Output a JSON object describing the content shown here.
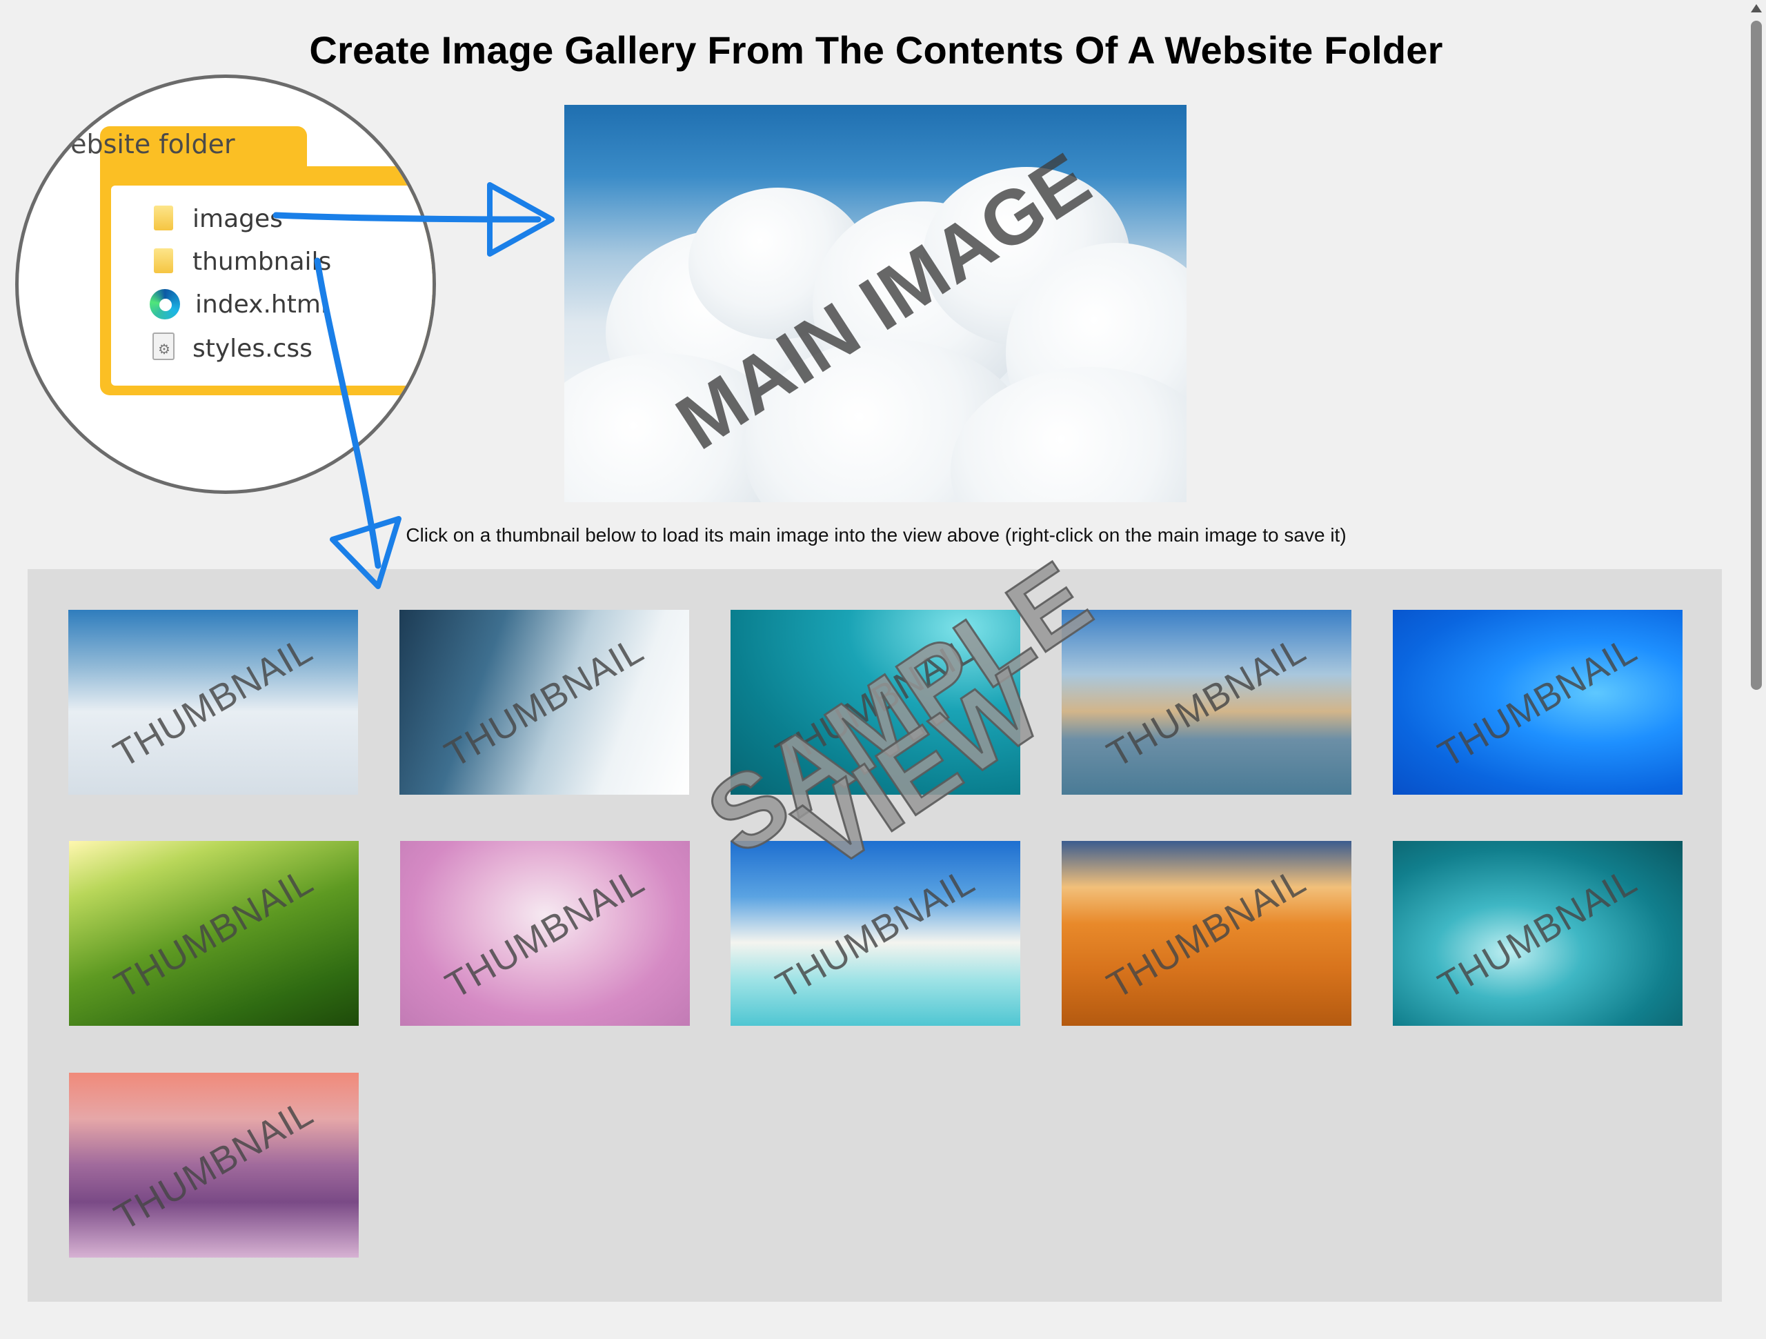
{
  "page": {
    "title": "Create Image Gallery From The Contents Of A Website Folder",
    "instructions": "Click on a thumbnail below to load its main image into the view above (right-click on the main image to save it)"
  },
  "folder_diagram": {
    "folder_name": "website folder",
    "items": [
      {
        "label": "images",
        "icon": "folder-icon"
      },
      {
        "label": "thumbnails",
        "icon": "folder-icon"
      },
      {
        "label": "index.html",
        "icon": "edge-browser-icon"
      },
      {
        "label": "styles.css",
        "icon": "css-file-icon"
      }
    ]
  },
  "main_view": {
    "watermark": "MAIN IMAGE",
    "subject": "clouds"
  },
  "overlay": {
    "line1": "SAMPLE",
    "line2": "VIEW"
  },
  "gallery": {
    "thumbnail_watermark": "THUMBNAIL",
    "thumbnails": [
      {
        "subject": "clouds"
      },
      {
        "subject": "waterfall"
      },
      {
        "subject": "underwater"
      },
      {
        "subject": "beach-rocks"
      },
      {
        "subject": "windows-logo"
      },
      {
        "subject": "meadow"
      },
      {
        "subject": "bird-blossom"
      },
      {
        "subject": "tropical-beach"
      },
      {
        "subject": "desert-sunset"
      },
      {
        "subject": "ocean-wave"
      },
      {
        "subject": "misty-mountains"
      }
    ]
  },
  "colors": {
    "background": "#f0f0f0",
    "gallery_background": "#dcdcdc",
    "arrow": "#1a7fe8",
    "folder": "#fbbf24"
  }
}
